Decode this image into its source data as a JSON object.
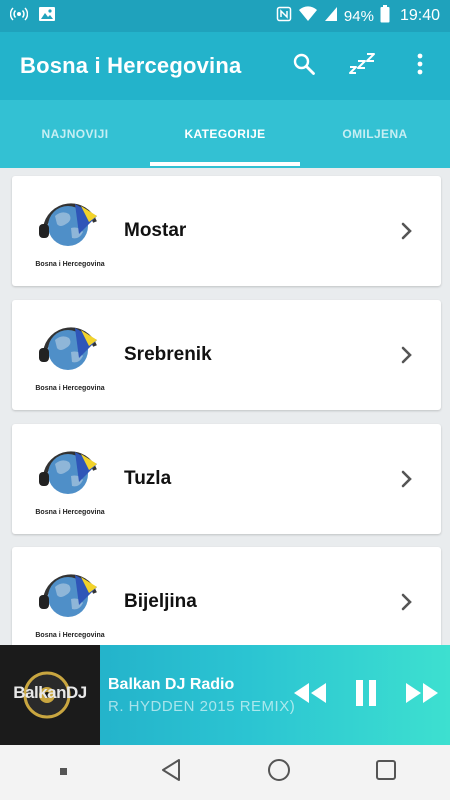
{
  "status_bar": {
    "battery": "94%",
    "time": "19:40"
  },
  "app_bar": {
    "title": "Bosna i Hercegovina"
  },
  "tabs": [
    {
      "label": "NAJNOVIJI",
      "active": false
    },
    {
      "label": "KATEGORIJE",
      "active": true
    },
    {
      "label": "OMILJENA",
      "active": false
    }
  ],
  "categories": [
    {
      "label": "Mostar",
      "logo_caption": "Bosna i Hercegovina"
    },
    {
      "label": "Srebrenik",
      "logo_caption": "Bosna i Hercegovina"
    },
    {
      "label": "Tuzla",
      "logo_caption": "Bosna i Hercegovina"
    },
    {
      "label": "Bijeljina",
      "logo_caption": "Bosna i Hercegovina"
    }
  ],
  "player": {
    "art_text": "BalkanDJ",
    "title": "Balkan DJ Radio",
    "subtitle": "R. HYDDEN 2015 REMIX)"
  },
  "colors": {
    "status_bar": "#1fa2bc",
    "app_bar": "#23b3cb",
    "tabs": "#33c1d3",
    "flag_blue": "#2f56b8",
    "flag_yellow": "#f2d32b"
  }
}
